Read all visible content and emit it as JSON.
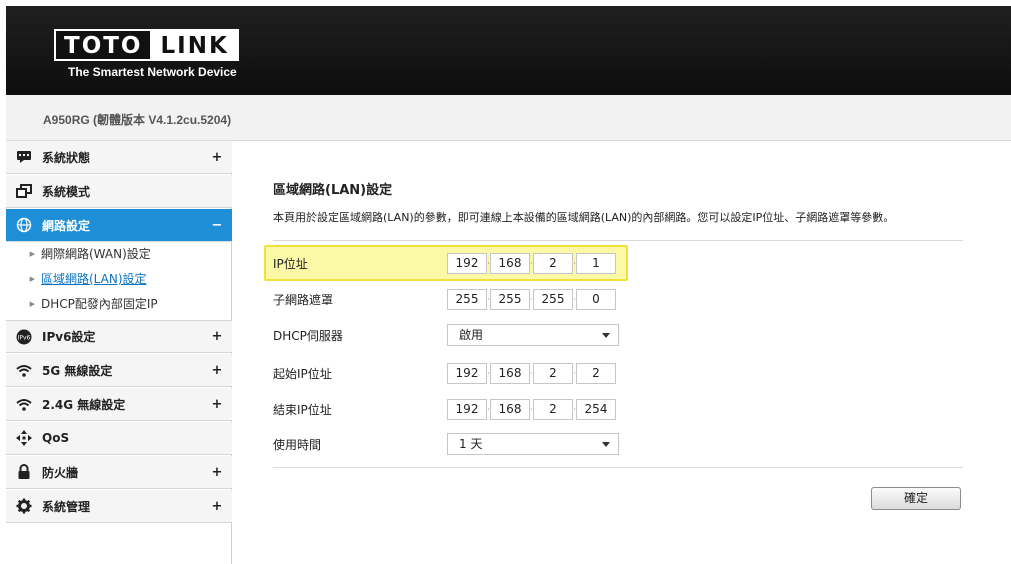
{
  "header": {
    "brand_left": "TOTO",
    "brand_right": "LINK",
    "tagline": "The Smartest Network Device"
  },
  "firmware": "A950RG (韌體版本 V4.1.2cu.5204)",
  "sidebar": {
    "items": [
      {
        "label": "系統狀態",
        "sign": "+",
        "icon": "status-icon"
      },
      {
        "label": "系統模式",
        "sign": "",
        "icon": "mode-icon"
      },
      {
        "label": "網路設定",
        "sign": "−",
        "icon": "globe-icon"
      },
      {
        "label": "IPv6設定",
        "sign": "+",
        "icon": "ipv6-icon"
      },
      {
        "label": "5G 無線設定",
        "sign": "+",
        "icon": "wifi-icon"
      },
      {
        "label": "2.4G 無線設定",
        "sign": "+",
        "icon": "wifi-icon"
      },
      {
        "label": "QoS",
        "sign": "",
        "icon": "qos-icon"
      },
      {
        "label": "防火牆",
        "sign": "+",
        "icon": "lock-icon"
      },
      {
        "label": "系統管理",
        "sign": "+",
        "icon": "gear-icon"
      }
    ],
    "sub_items": [
      {
        "label": "網際網路(WAN)設定"
      },
      {
        "label": "區域網路(LAN)設定"
      },
      {
        "label": "DHCP配發內部固定IP"
      }
    ],
    "active_color": "#1e8fd6"
  },
  "main": {
    "title": "區域網路(LAN)設定",
    "description": "本頁用於設定區域網路(LAN)的參數，即可連線上本設備的區域網路(LAN)的內部網路。您可以設定IP位址、子網路遮罩等參數。",
    "fields": {
      "ip": {
        "label": "IP位址",
        "octets": [
          "192",
          "168",
          "2",
          "1"
        ]
      },
      "subnet": {
        "label": "子網路遮罩",
        "octets": [
          "255",
          "255",
          "255",
          "0"
        ]
      },
      "dhcp": {
        "label": "DHCP伺服器",
        "value": "啟用"
      },
      "start_ip": {
        "label": "起始IP位址",
        "octets": [
          "192",
          "168",
          "2",
          "2"
        ]
      },
      "end_ip": {
        "label": "結束IP位址",
        "octets": [
          "192",
          "168",
          "2",
          "254"
        ]
      },
      "lease": {
        "label": "使用時間",
        "value": "1 天"
      }
    },
    "confirm_label": "確定",
    "highlight_color": "#f0e23a"
  }
}
